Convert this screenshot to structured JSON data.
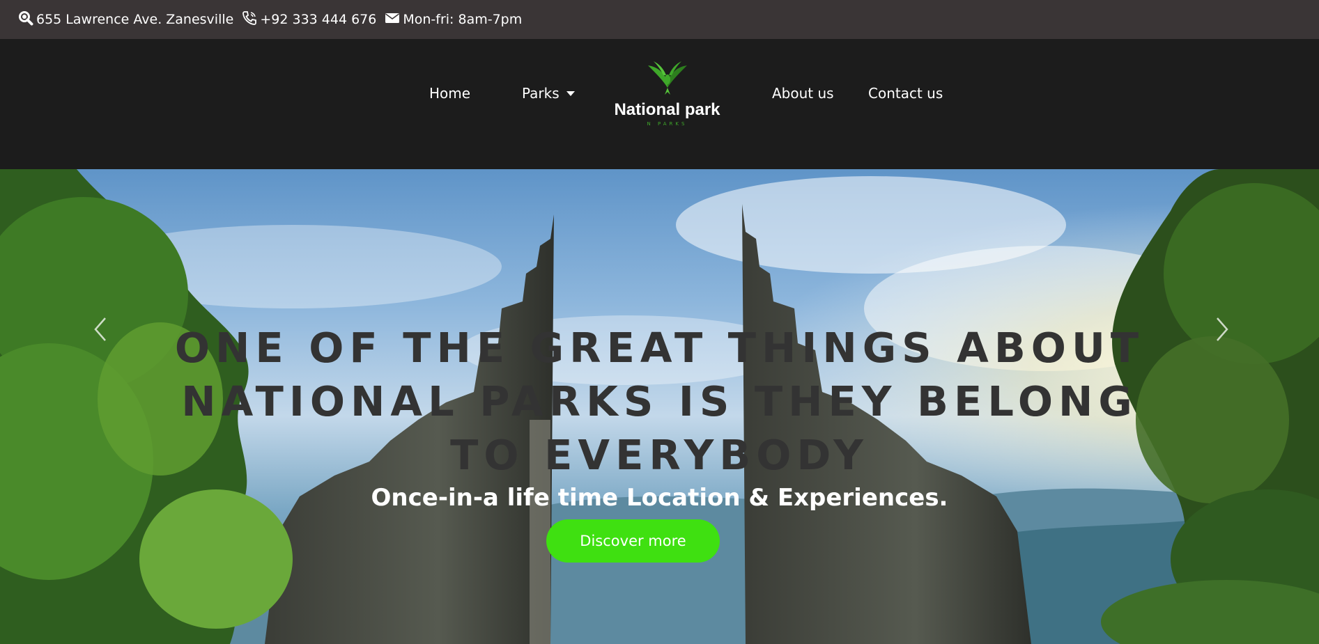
{
  "topbar": {
    "address": "655 Lawrence Ave. Zanesville",
    "address_icon": "search-icon",
    "phone": "+92 333 444 676",
    "phone_icon": "phone-icon",
    "hours": "Mon-fri: 8am-7pm",
    "hours_icon": "envelope-icon"
  },
  "nav": {
    "items": [
      {
        "label": "Home"
      },
      {
        "label": "Parks",
        "has_dropdown": true
      },
      {
        "label": "About us"
      },
      {
        "label": "Contact us"
      }
    ],
    "brand": {
      "title": "National park",
      "subtitle": "N PARKS",
      "logo_icon": "bird-logo-icon"
    }
  },
  "hero": {
    "heading": "ONE OF THE GREAT THINGS ABOUT NATIONAL PARKS IS THEY BELONG TO EVERYBODY",
    "subheading": "Once-in-a life time Location & Experiences.",
    "cta_label": "Discover more",
    "prev_icon": "chevron-left-icon",
    "next_icon": "chevron-right-icon"
  },
  "colors": {
    "topbar_bg": "#3a3536",
    "navbar_bg": "#1c1c1c",
    "accent_green": "#3fe011",
    "heading_text": "#333333"
  }
}
